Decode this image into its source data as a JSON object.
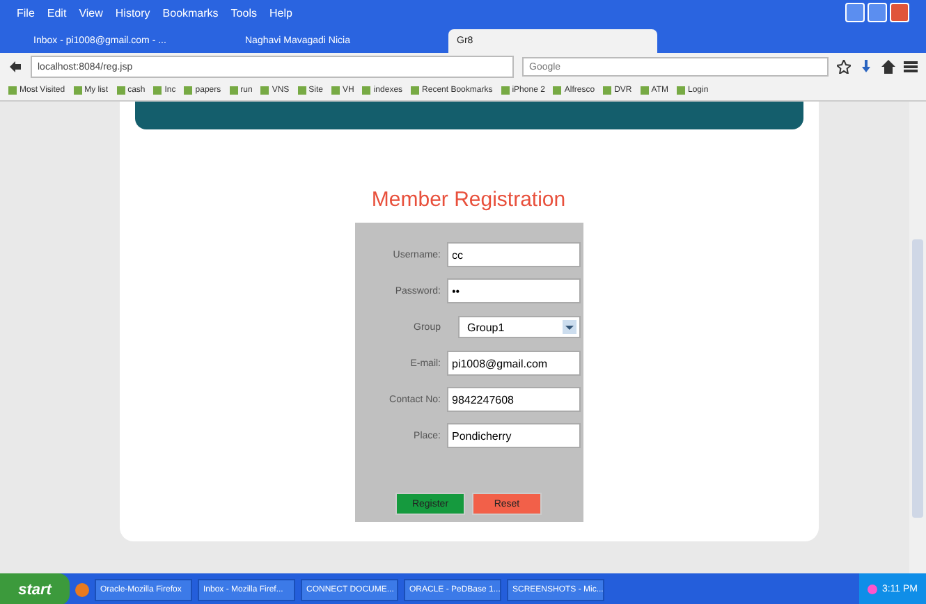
{
  "menu_bar": [
    "File",
    "Edit",
    "View",
    "History",
    "Bookmarks",
    "Tools",
    "Help"
  ],
  "tabs": [
    {
      "title": "Inbox - pi1008@gmail.com - ...",
      "selected": false
    },
    {
      "title": "Naghavi Mavagadi Nicia",
      "selected": false
    },
    {
      "title": "Gr8",
      "selected": true
    }
  ],
  "address_bar": {
    "url": "localhost:8084/reg.jsp"
  },
  "search_field": {
    "placeholder": "Google"
  },
  "bookmarks": [
    "Most Visited",
    "My list",
    "cash",
    "Inc",
    "papers",
    "run",
    "VNS",
    "Site",
    "VH",
    "indexes",
    "Recent Bookmarks",
    "iPhone 2",
    "Alfresco",
    "DVR",
    "ATM",
    "Login"
  ],
  "page": {
    "title": "Member Registration",
    "fields": [
      {
        "label": "Username:",
        "kind": "text",
        "value": "cc"
      },
      {
        "label": "Password:",
        "kind": "password",
        "value": "••"
      },
      {
        "label": "Group",
        "kind": "select",
        "value": "Group1"
      },
      {
        "label": "E-mail:",
        "kind": "text",
        "value": "pi1008@gmail.com"
      },
      {
        "label": "Contact No:",
        "kind": "text",
        "value": "9842247608"
      },
      {
        "label": "Place:",
        "kind": "text",
        "value": "Pondicherry"
      }
    ],
    "buttons": [
      {
        "label": "Register",
        "kind": "primary"
      },
      {
        "label": "Reset",
        "kind": "danger"
      }
    ]
  },
  "taskbar": {
    "start": "start",
    "tasks": [
      "Oracle-Mozilla Firefox",
      "Inbox - Mozilla Firef...",
      "CONNECT DOCUME...",
      "ORACLE - PeDBase 1...",
      "SCREENSHOTS - Mic..."
    ],
    "clock": "3:11 PM"
  }
}
